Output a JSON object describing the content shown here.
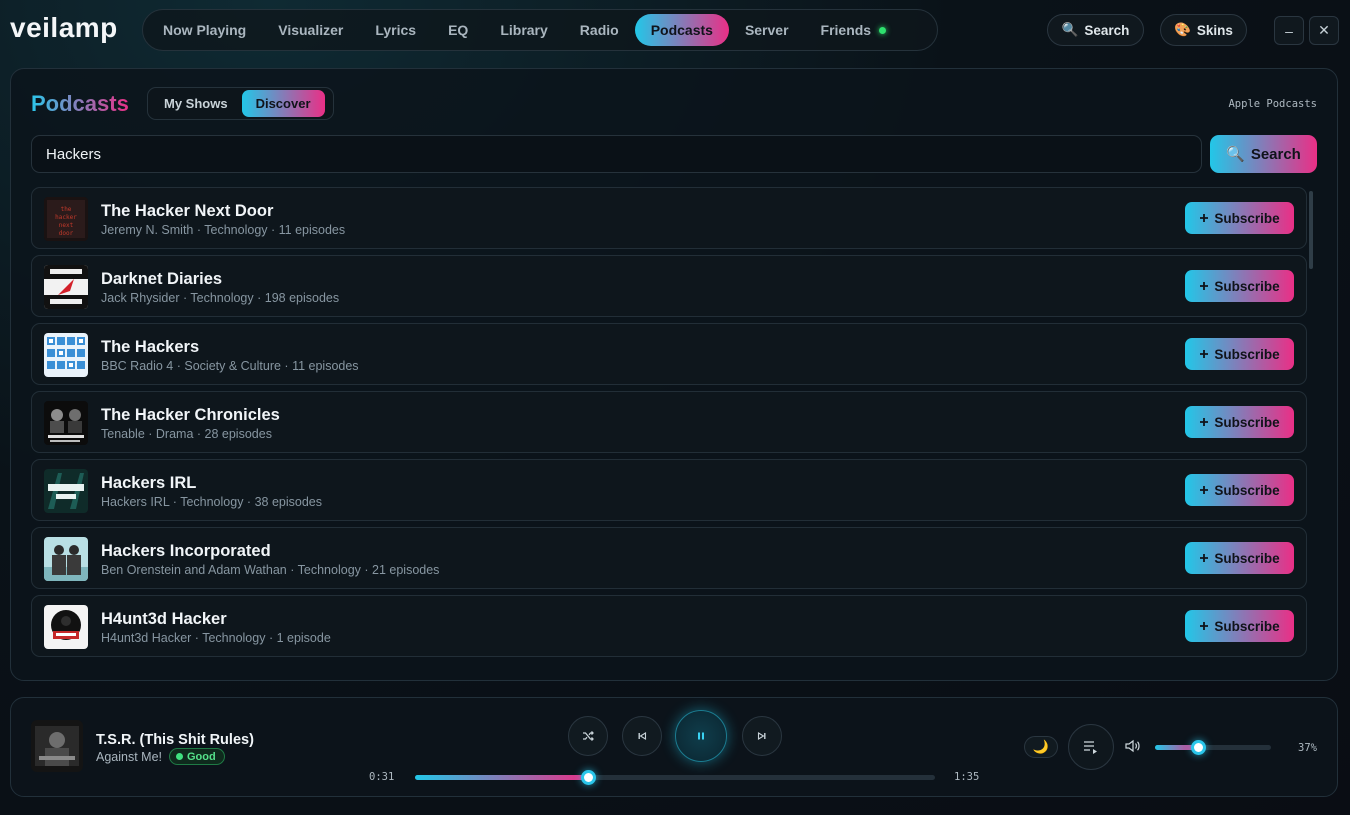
{
  "app": {
    "name": "veilamp"
  },
  "nav": {
    "tabs": [
      {
        "label": "Now Playing",
        "active": false
      },
      {
        "label": "Visualizer",
        "active": false
      },
      {
        "label": "Lyrics",
        "active": false
      },
      {
        "label": "EQ",
        "active": false
      },
      {
        "label": "Library",
        "active": false
      },
      {
        "label": "Radio",
        "active": false
      },
      {
        "label": "Podcasts",
        "active": true
      },
      {
        "label": "Server",
        "active": false
      },
      {
        "label": "Friends",
        "active": false,
        "status_dot": "online"
      }
    ],
    "search_label": "Search",
    "skins_label": "Skins",
    "minimize_glyph": "–",
    "close_glyph": "✕"
  },
  "podcasts": {
    "title": "Podcasts",
    "segments": [
      {
        "label": "My Shows",
        "active": false
      },
      {
        "label": "Discover",
        "active": true
      }
    ],
    "source_label": "Apple Podcasts",
    "search_value": "Hackers",
    "search_button": "Search",
    "subscribe_label": "Subscribe",
    "results": [
      {
        "title": "The Hacker Next Door",
        "author": "Jeremy N. Smith",
        "genre": "Technology",
        "episodes": "11 episodes",
        "art": "hacker-next-door"
      },
      {
        "title": "Darknet Diaries",
        "author": "Jack Rhysider",
        "genre": "Technology",
        "episodes": "198 episodes",
        "art": "darknet-diaries"
      },
      {
        "title": "The Hackers",
        "author": "BBC Radio 4",
        "genre": "Society & Culture",
        "episodes": "11 episodes",
        "art": "the-hackers"
      },
      {
        "title": "The Hacker Chronicles",
        "author": "Tenable",
        "genre": "Drama",
        "episodes": "28 episodes",
        "art": "hacker-chronicles"
      },
      {
        "title": "Hackers IRL",
        "author": "Hackers IRL",
        "genre": "Technology",
        "episodes": "38 episodes",
        "art": "hackers-irl"
      },
      {
        "title": "Hackers Incorporated",
        "author": "Ben Orenstein and Adam Wathan",
        "genre": "Technology",
        "episodes": "21 episodes",
        "art": "hackers-incorporated"
      },
      {
        "title": "H4unt3d Hacker",
        "author": "H4unt3d Hacker",
        "genre": "Technology",
        "episodes": "1 episode",
        "art": "h4unt3d-hacker"
      }
    ]
  },
  "player": {
    "track_title": "T.S.R. (This Shit Rules)",
    "artist": "Against Me!",
    "quality_badge": "Good",
    "elapsed": "0:31",
    "duration": "1:35",
    "progress": 0.333,
    "volume": 0.37,
    "volume_label": "37%",
    "state": "playing"
  },
  "colors": {
    "accent_cyan": "#22c7e8",
    "accent_pink": "#ea2f86",
    "online_green": "#2ee06e",
    "background": "#0a1218"
  },
  "icons": {
    "search": "magnifier-icon",
    "skins": "palette-icon",
    "shuffle": "shuffle-icon",
    "previous": "skip-back-icon",
    "pause": "pause-icon",
    "next": "skip-forward-icon",
    "theme": "moon-icon",
    "queue": "queue-list-icon",
    "volume": "speaker-icon"
  }
}
